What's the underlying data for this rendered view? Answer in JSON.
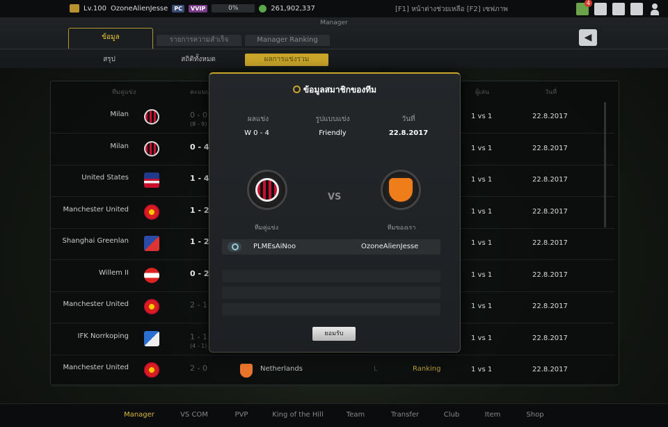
{
  "topbar": {
    "level": "Lv.100",
    "username": "OzoneAlienJesse",
    "pc_badge": "PC",
    "vvip_badge": "VVIP",
    "xp_percent": "0%",
    "xp_fraction": 0,
    "coins": "261,902,337",
    "hint": "[F1] หน้าต่างช่วยเหลือ [F2] เซฟภาพ",
    "mail_count": "4"
  },
  "header": {
    "mode_title": "Manager",
    "tabs": [
      "ข้อมูล",
      "รายการความสำเร็จ",
      "Manager Ranking"
    ],
    "subtabs": [
      "สรุป",
      "สถิติทั้งหมด",
      "ผลการแข่งรวม"
    ]
  },
  "table": {
    "headers": [
      "ทีมคู่แข่ง",
      "คะแนน",
      "ผู้เล่น",
      "วันที่"
    ],
    "rows": [
      {
        "opponent": "Milan",
        "crest": "milan",
        "score": "0 - 0",
        "sub": "(8 - 9)",
        "dim": true,
        "match": "1 vs 1",
        "date": "22.8.2017"
      },
      {
        "opponent": "Milan",
        "crest": "milan",
        "score": "0 - 4",
        "sub": "",
        "dim": false,
        "match": "1 vs 1",
        "date": "22.8.2017"
      },
      {
        "opponent": "United States",
        "crest": "usa",
        "score": "1 - 4",
        "sub": "",
        "dim": false,
        "match": "1 vs 1",
        "date": "22.8.2017"
      },
      {
        "opponent": "Manchester United",
        "crest": "manu",
        "score": "1 - 2",
        "sub": "",
        "dim": false,
        "match": "1 vs 1",
        "date": "22.8.2017"
      },
      {
        "opponent": "Shanghai Greenlan",
        "crest": "shanghai",
        "score": "1 - 2",
        "sub": "",
        "dim": false,
        "match": "1 vs 1",
        "date": "22.8.2017"
      },
      {
        "opponent": "Willem II",
        "crest": "willem",
        "score": "0 - 2",
        "sub": "",
        "dim": false,
        "match": "1 vs 1",
        "date": "22.8.2017"
      },
      {
        "opponent": "Manchester United",
        "crest": "manu",
        "score": "2 - 1",
        "sub": "",
        "dim": true,
        "match": "1 vs 1",
        "date": "22.8.2017"
      },
      {
        "opponent": "IFK Norrkoping",
        "crest": "ifk",
        "score": "1 - 1",
        "sub": "(4 - 1)",
        "dim": true,
        "match": "1 vs 1",
        "date": "22.8.2017"
      },
      {
        "opponent": "Manchester United",
        "crest": "manu",
        "score": "2 - 0",
        "sub": "",
        "dim": true,
        "match": "1 vs 1",
        "date": "22.8.2017",
        "own_team": "Netherlands",
        "result": "L",
        "type": "Ranking"
      }
    ]
  },
  "modal": {
    "title": "ข้อมูลสมาชิกของทีม",
    "labels": [
      "ผลแข่ง",
      "รูปแบบแข่ง",
      "วันที่"
    ],
    "result": "W  0 - 4",
    "format": "Friendly",
    "date": "22.8.2017",
    "vs": "VS",
    "opponent_label": "ทีมคู่แข่ง",
    "own_label": "ทีมของเรา",
    "opponent_player": "PLMEsAiNoo",
    "own_player": "OzoneAlienJesse",
    "ok": "ยอมรับ"
  },
  "bottom_nav": [
    "Manager",
    "VS COM",
    "PVP",
    "King of the Hill",
    "Team",
    "Transfer",
    "Club",
    "Item",
    "Shop"
  ],
  "colors": {
    "accent": "#c9a52a",
    "active_nav": "#d8b93a"
  }
}
